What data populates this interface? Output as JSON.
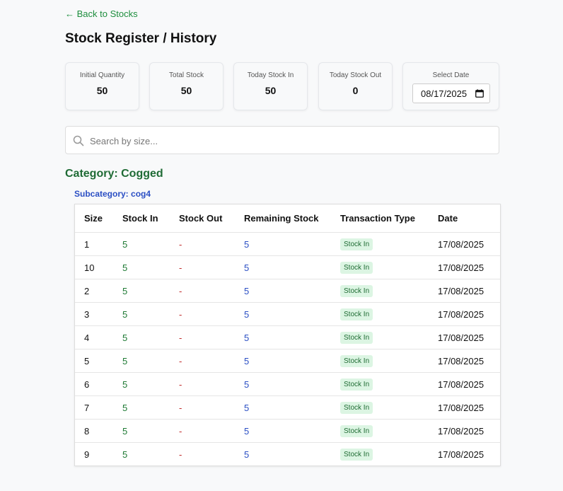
{
  "nav": {
    "back_label": "← Back to Stocks"
  },
  "page": {
    "title": "Stock Register / History"
  },
  "summary": {
    "initial_quantity": {
      "label": "Initial Quantity",
      "value": "50"
    },
    "total_stock": {
      "label": "Total Stock",
      "value": "50"
    },
    "today_stock_in": {
      "label": "Today Stock In",
      "value": "50"
    },
    "today_stock_out": {
      "label": "Today Stock Out",
      "value": "0"
    },
    "select_date": {
      "label": "Select Date",
      "value": "08/17/2025"
    }
  },
  "search": {
    "placeholder": "Search by size...",
    "value": ""
  },
  "category": {
    "title": "Category: Cogged"
  },
  "subcategory": {
    "title": "Subcategory: cog4"
  },
  "table": {
    "headers": [
      "Size",
      "Stock In",
      "Stock Out",
      "Remaining Stock",
      "Transaction Type",
      "Date"
    ],
    "rows": [
      {
        "size": "1",
        "stock_in": "5",
        "stock_out": "-",
        "remaining": "5",
        "type": "Stock In",
        "date": "17/08/2025"
      },
      {
        "size": "10",
        "stock_in": "5",
        "stock_out": "-",
        "remaining": "5",
        "type": "Stock In",
        "date": "17/08/2025"
      },
      {
        "size": "2",
        "stock_in": "5",
        "stock_out": "-",
        "remaining": "5",
        "type": "Stock In",
        "date": "17/08/2025"
      },
      {
        "size": "3",
        "stock_in": "5",
        "stock_out": "-",
        "remaining": "5",
        "type": "Stock In",
        "date": "17/08/2025"
      },
      {
        "size": "4",
        "stock_in": "5",
        "stock_out": "-",
        "remaining": "5",
        "type": "Stock In",
        "date": "17/08/2025"
      },
      {
        "size": "5",
        "stock_in": "5",
        "stock_out": "-",
        "remaining": "5",
        "type": "Stock In",
        "date": "17/08/2025"
      },
      {
        "size": "6",
        "stock_in": "5",
        "stock_out": "-",
        "remaining": "5",
        "type": "Stock In",
        "date": "17/08/2025"
      },
      {
        "size": "7",
        "stock_in": "5",
        "stock_out": "-",
        "remaining": "5",
        "type": "Stock In",
        "date": "17/08/2025"
      },
      {
        "size": "8",
        "stock_in": "5",
        "stock_out": "-",
        "remaining": "5",
        "type": "Stock In",
        "date": "17/08/2025"
      },
      {
        "size": "9",
        "stock_in": "5",
        "stock_out": "-",
        "remaining": "5",
        "type": "Stock In",
        "date": "17/08/2025"
      }
    ]
  },
  "colors": {
    "back_link": "#1e8e3e",
    "category": "#1f6b35",
    "subcategory": "#2b4fc4",
    "stock_in": "#1e7a34",
    "stock_out": "#c02a2a",
    "remaining": "#2b4fc4",
    "badge_bg": "#dcf5e3",
    "badge_text": "#1e6b33"
  },
  "icons": {
    "search": "search-icon",
    "calendar": "calendar-icon"
  }
}
